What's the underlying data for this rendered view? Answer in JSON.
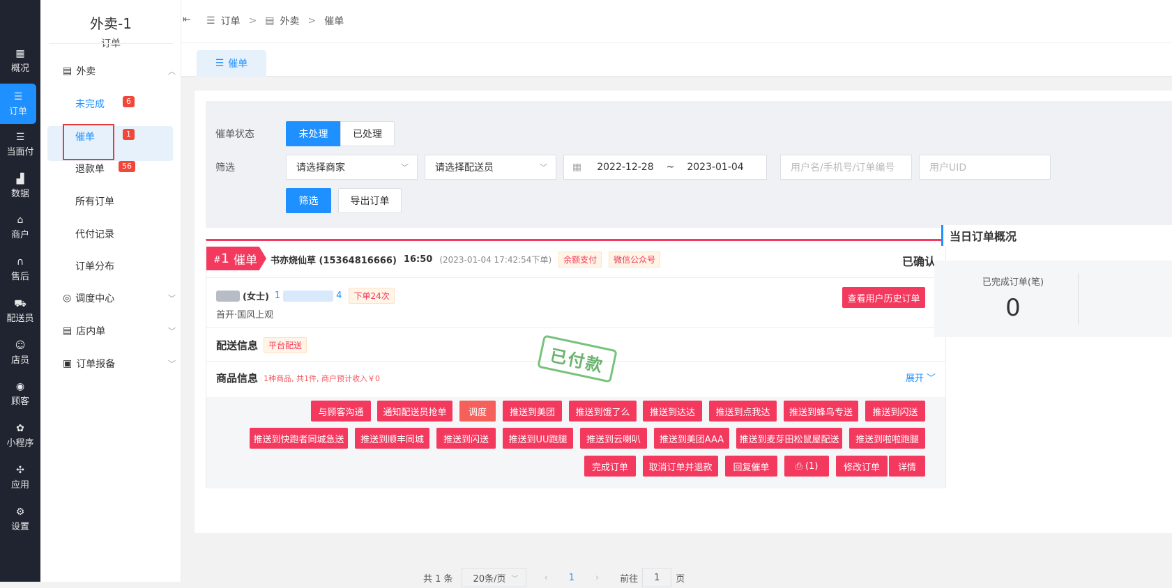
{
  "rail": [
    {
      "label": "概况",
      "icon": "dashboard-icon"
    },
    {
      "label": "订单",
      "icon": "list-icon"
    },
    {
      "label": "当面付",
      "icon": "list-icon"
    },
    {
      "label": "数据",
      "icon": "bar-chart-icon"
    },
    {
      "label": "商户",
      "icon": "store-icon"
    },
    {
      "label": "售后",
      "icon": "headset-icon"
    },
    {
      "label": "配送员",
      "icon": "scooter-icon"
    },
    {
      "label": "店员",
      "icon": "users-icon"
    },
    {
      "label": "顾客",
      "icon": "user-circle-icon"
    },
    {
      "label": "小程序",
      "icon": "wechat-icon"
    },
    {
      "label": "应用",
      "icon": "apps-icon"
    },
    {
      "label": "设置",
      "icon": "user-gear-icon"
    }
  ],
  "sidebar": {
    "title": "外卖-1",
    "subtitle": "订单",
    "group_waimai": "外卖",
    "items": [
      {
        "label": "未完成",
        "badge": "6"
      },
      {
        "label": "催单",
        "badge": "1"
      },
      {
        "label": "退款单",
        "badge": "56"
      },
      {
        "label": "所有订单"
      },
      {
        "label": "代付记录"
      },
      {
        "label": "订单分布"
      }
    ],
    "group_dispatch": "调度中心",
    "group_instore": "店内单",
    "group_report": "订单报备"
  },
  "breadcrumb": {
    "c1": "订单",
    "sep": ">",
    "c2": "外卖",
    "c3": "催单"
  },
  "tab": "催单",
  "filter": {
    "status_label": "催单状态",
    "status_unprocessed": "未处理",
    "status_processed": "已处理",
    "filter_label": "筛选",
    "merchant_placeholder": "请选择商家",
    "courier_placeholder": "请选择配送员",
    "date_start": "2022-12-28",
    "date_sep": "~",
    "date_end": "2023-01-04",
    "user_search_placeholder": "用户名/手机号/订单编号",
    "uid_placeholder": "用户UID",
    "filter_button": "筛选",
    "export_button": "导出订单"
  },
  "order": {
    "ribbon_hash": "#",
    "ribbon_num": "1",
    "ribbon_label": "催单",
    "store": "书亦烧仙草 (15364816666)",
    "time": "16:50",
    "placed": "(2023-01-04 17:42:54下单)",
    "tag_pay": "余额支付",
    "tag_channel": "微信公众号",
    "status": "已确认",
    "customer_suffix": "(女士)",
    "phone_prefix": "1",
    "phone_suffix": "4",
    "order_count": "下单24次",
    "address": "首开·国风上观",
    "history_button": "查看用户历史订单",
    "delivery_title": "配送信息",
    "delivery_tag": "平台配送",
    "goods_title": "商品信息",
    "goods_summary": "1种商品, 共1件, 商户预计收入￥0",
    "expand": "展开",
    "stamp": "已付款",
    "actions_row1": [
      "与顾客沟通",
      "通知配送员抢单",
      "调度",
      "推送到美团",
      "推送到饿了么",
      "推送到达达",
      "推送到点我达",
      "推送到蜂鸟专送",
      "推送到闪送"
    ],
    "actions_row2": [
      "推送到快跑者同城急送",
      "推送到顺丰同城",
      "推送到闪送",
      "推送到UU跑腿",
      "推送到云喇叭",
      "推送到美团AAA",
      "推送到麦芽田松鼠屋配送",
      "推送到啦啦跑腿"
    ],
    "actions_row3": [
      "完成订单",
      "取消订单并退款",
      "回复催单",
      "(1)",
      "修改订单",
      "详情"
    ]
  },
  "summary": {
    "title": "当日订单概况",
    "completed_label": "已完成订单(笔)",
    "completed_value": "0"
  },
  "pagination": {
    "total": "共 1 条",
    "page_size": "20条/页",
    "current": "1",
    "goto_label": "前往",
    "goto_value": "1",
    "page_unit": "页"
  }
}
